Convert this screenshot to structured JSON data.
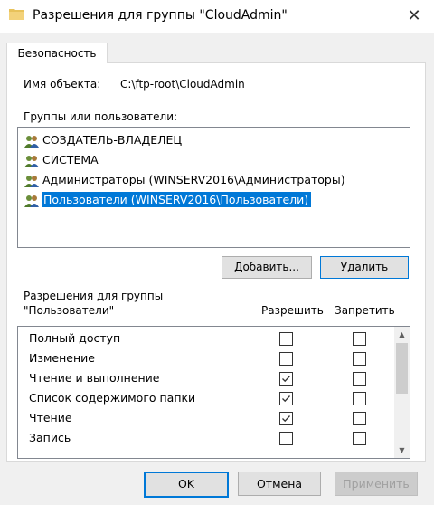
{
  "window": {
    "title": "Разрешения для группы \"CloudAdmin\"",
    "close_glyph": "✕"
  },
  "tab": {
    "label": "Безопасность"
  },
  "object": {
    "label": "Имя объекта:",
    "value": "C:\\ftp-root\\CloudAdmin"
  },
  "groups": {
    "label": "Группы или пользователи:",
    "items": [
      {
        "name": "СОЗДАТЕЛЬ-ВЛАДЕЛЕЦ",
        "icon": "user-group-icon",
        "selected": false
      },
      {
        "name": "СИСТЕМА",
        "icon": "user-group-icon",
        "selected": false
      },
      {
        "name": "Администраторы (WINSERV2016\\Администраторы)",
        "icon": "user-group-icon",
        "selected": false
      },
      {
        "name": "Пользователи (WINSERV2016\\Пользователи)",
        "icon": "user-group-icon",
        "selected": true
      }
    ],
    "add_button": "Добавить...",
    "remove_button": "Удалить"
  },
  "permissions": {
    "label_line1": "Разрешения для группы",
    "label_line2": "\"Пользователи\"",
    "allow_header": "Разрешить",
    "deny_header": "Запретить",
    "rows": [
      {
        "name": "Полный доступ",
        "allow": false,
        "deny": false
      },
      {
        "name": "Изменение",
        "allow": false,
        "deny": false
      },
      {
        "name": "Чтение и выполнение",
        "allow": true,
        "deny": false
      },
      {
        "name": "Список содержимого папки",
        "allow": true,
        "deny": false
      },
      {
        "name": "Чтение",
        "allow": true,
        "deny": false
      },
      {
        "name": "Запись",
        "allow": false,
        "deny": false
      }
    ]
  },
  "footer": {
    "ok": "OK",
    "cancel": "Отмена",
    "apply": "Применить"
  },
  "colors": {
    "selection": "#0078d7",
    "focus_border": "#0078d7",
    "panel_bg": "#f0f0f0"
  }
}
